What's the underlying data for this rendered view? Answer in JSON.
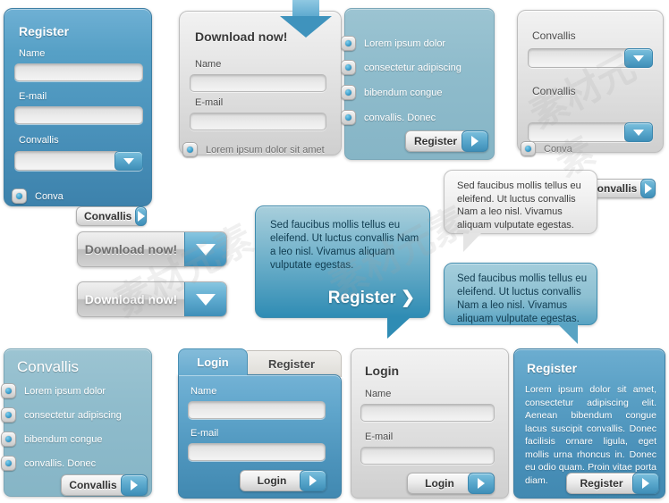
{
  "panels": {
    "register_blue": {
      "title": "Register",
      "name_label": "Name",
      "email_label": "E-mail",
      "convallis_label": "Convallis",
      "radio_label": "Conva",
      "button_label": "Convallis"
    },
    "download_gray": {
      "title": "Download now!",
      "name_label": "Name",
      "email_label": "E-mail",
      "radio_label": "Lorem ipsum dolor sit  amet",
      "arrow_icon": "arrow-down-icon"
    },
    "list_teal": {
      "items": [
        "Lorem   ipsum   dolor",
        "consectetur adipiscing",
        "bibendum  congue",
        "convallis.  Donec"
      ],
      "button_label": "Register"
    },
    "selects_gray": {
      "label_one": "Convallis",
      "label_two": "Convallis",
      "radio_label": "Conva",
      "button_label": "Convallis"
    },
    "convallis_teal": {
      "title": "Convallis",
      "items": [
        "Lorem   ipsum   dolor",
        "consectetur adipiscing",
        "bibendum  congue",
        "convallis.  Donec"
      ],
      "button_label": "Convallis"
    },
    "tabs_login": {
      "tab_active": "Login",
      "tab_inactive": "Register",
      "name_label": "Name",
      "email_label": "E-mail",
      "button_label": "Login"
    },
    "login_gray": {
      "title": "Login",
      "name_label": "Name",
      "email_label": "E-mail",
      "button_label": "Login"
    },
    "register_body": {
      "title": "Register",
      "body": "Lorem ipsum dolor sit amet, consectetur adipiscing elit. Aenean bibendum congue lacus suscipit convallis. Donec facilisis ornare ligula, eget mollis urna rhoncus in. Donec eu odio quam. Proin vitae porta diam.",
      "button_label": "Register"
    }
  },
  "download_buttons": [
    {
      "label": "Download now!",
      "icon": "arrow-down-icon"
    },
    {
      "label": "Download now!",
      "icon": "arrow-down-icon"
    }
  ],
  "bubbles": {
    "teal_register": {
      "text": "Sed faucibus mollis tellus eu eleifend. Ut luctus convallis Nam a leo nisl. Vivamus aliquam vulputate egestas.",
      "cta": "Register ❯"
    },
    "gray_top": {
      "text": "Sed faucibus mollis tellus eu eleifend. Ut luctus convallis Nam a leo nisl. Vivamus aliquam vulputate egestas."
    },
    "teal_bottom": {
      "text": "Sed faucibus mollis tellus eu eleifend. Ut luctus convallis Nam a leo nisl. Vivamus aliquam vulputate egestas."
    }
  },
  "colors": {
    "blue_panel": "#56a0c6",
    "teal_panel": "#8fbccc",
    "gray_panel": "#e6e6e6",
    "accent_knob": "#3f8fb8",
    "bubble_teal_bottom": "#2f8cb4"
  },
  "watermark": "素材元素"
}
